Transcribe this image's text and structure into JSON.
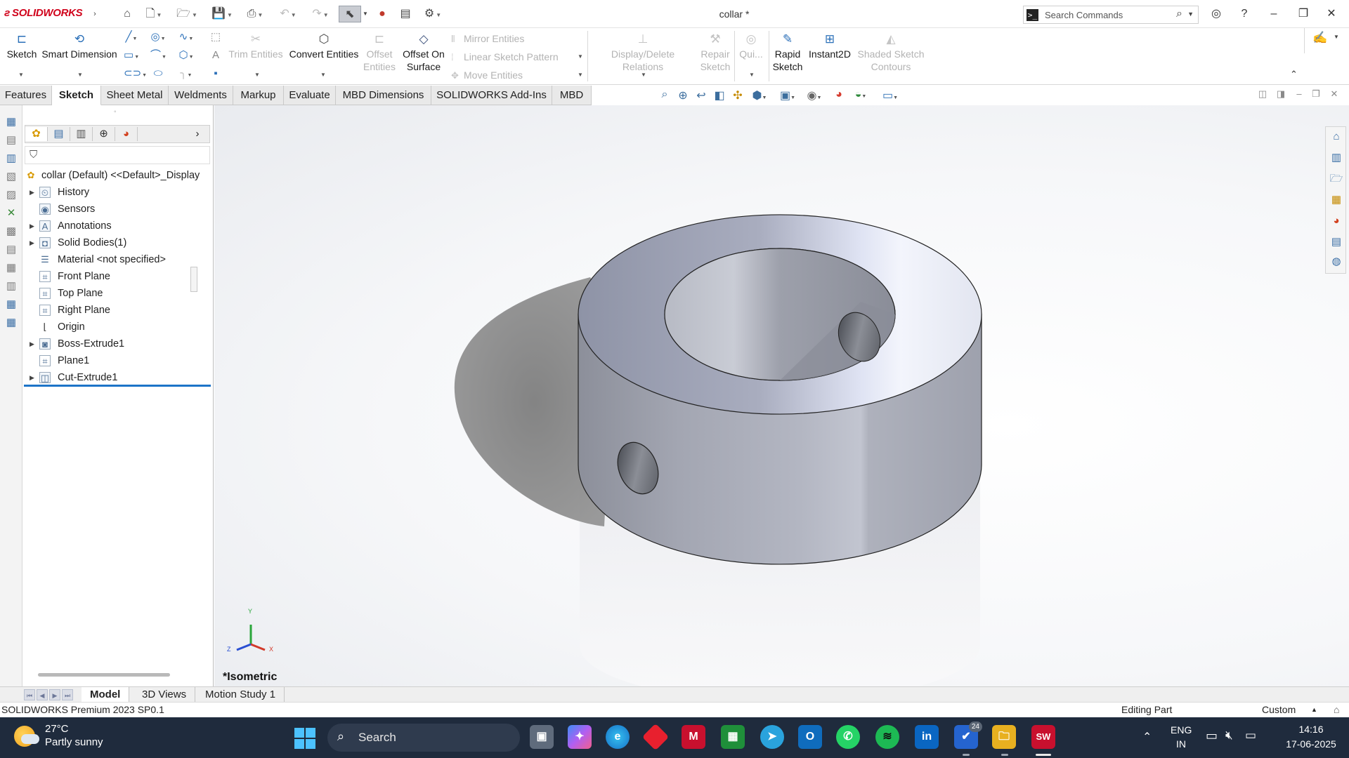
{
  "app": {
    "name": "SOLIDWORKS",
    "document_title": "collar *",
    "search_placeholder": "Search Commands"
  },
  "ribbon": {
    "sketch": "Sketch",
    "smart_dimension": "Smart Dimension",
    "trim_entities": "Trim Entities",
    "convert_entities": "Convert Entities",
    "offset_entities": "Offset Entities",
    "offset_on_surface": "Offset On Surface",
    "mirror_entities": "Mirror Entities",
    "linear_sketch_pattern": "Linear Sketch Pattern",
    "move_entities": "Move Entities",
    "display_delete_relations": "Display/Delete Relations",
    "repair_sketch": "Repair Sketch",
    "quick_snaps": "Qui...",
    "rapid_sketch": "Rapid Sketch",
    "instant2d": "Instant2D",
    "shaded_sketch_contours": "Shaded Sketch Contours"
  },
  "tabs": [
    "Features",
    "Sketch",
    "Sheet Metal",
    "Weldments",
    "Markup",
    "Evaluate",
    "MBD Dimensions",
    "SOLIDWORKS Add-Ins",
    "MBD"
  ],
  "active_tab": "Sketch",
  "feature_tree": {
    "root": "collar (Default) <<Default>_Display",
    "items": [
      {
        "label": "History",
        "expandable": true,
        "icon": "history-icon"
      },
      {
        "label": "Sensors",
        "expandable": false,
        "icon": "sensors-icon"
      },
      {
        "label": "Annotations",
        "expandable": true,
        "icon": "annotations-icon"
      },
      {
        "label": "Solid Bodies(1)",
        "expandable": true,
        "icon": "solid-bodies-icon"
      },
      {
        "label": "Material <not specified>",
        "expandable": false,
        "icon": "material-icon"
      },
      {
        "label": "Front Plane",
        "expandable": false,
        "icon": "plane-icon"
      },
      {
        "label": "Top Plane",
        "expandable": false,
        "icon": "plane-icon"
      },
      {
        "label": "Right Plane",
        "expandable": false,
        "icon": "plane-icon"
      },
      {
        "label": "Origin",
        "expandable": false,
        "icon": "origin-icon"
      },
      {
        "label": "Boss-Extrude1",
        "expandable": true,
        "icon": "extrude-icon"
      },
      {
        "label": "Plane1",
        "expandable": false,
        "icon": "plane-icon"
      },
      {
        "label": "Cut-Extrude1",
        "expandable": true,
        "icon": "cut-extrude-icon"
      }
    ]
  },
  "viewport": {
    "view_label": "*Isometric",
    "triad": {
      "x": "X",
      "y": "Y",
      "z": "Z"
    }
  },
  "bottom_tabs": [
    "Model",
    "3D Views",
    "Motion Study 1"
  ],
  "active_bottom_tab": "Model",
  "status": {
    "version": "SOLIDWORKS Premium 2023 SP0.1",
    "mode": "Editing Part",
    "units": "Custom"
  },
  "taskbar": {
    "temperature": "27°C",
    "weather": "Partly sunny",
    "search": "Search",
    "todo_badge": "24",
    "lang_top": "ENG",
    "lang_bottom": "IN",
    "time": "14:16",
    "date": "17-06-2025",
    "solidworks_tile": "SW"
  }
}
